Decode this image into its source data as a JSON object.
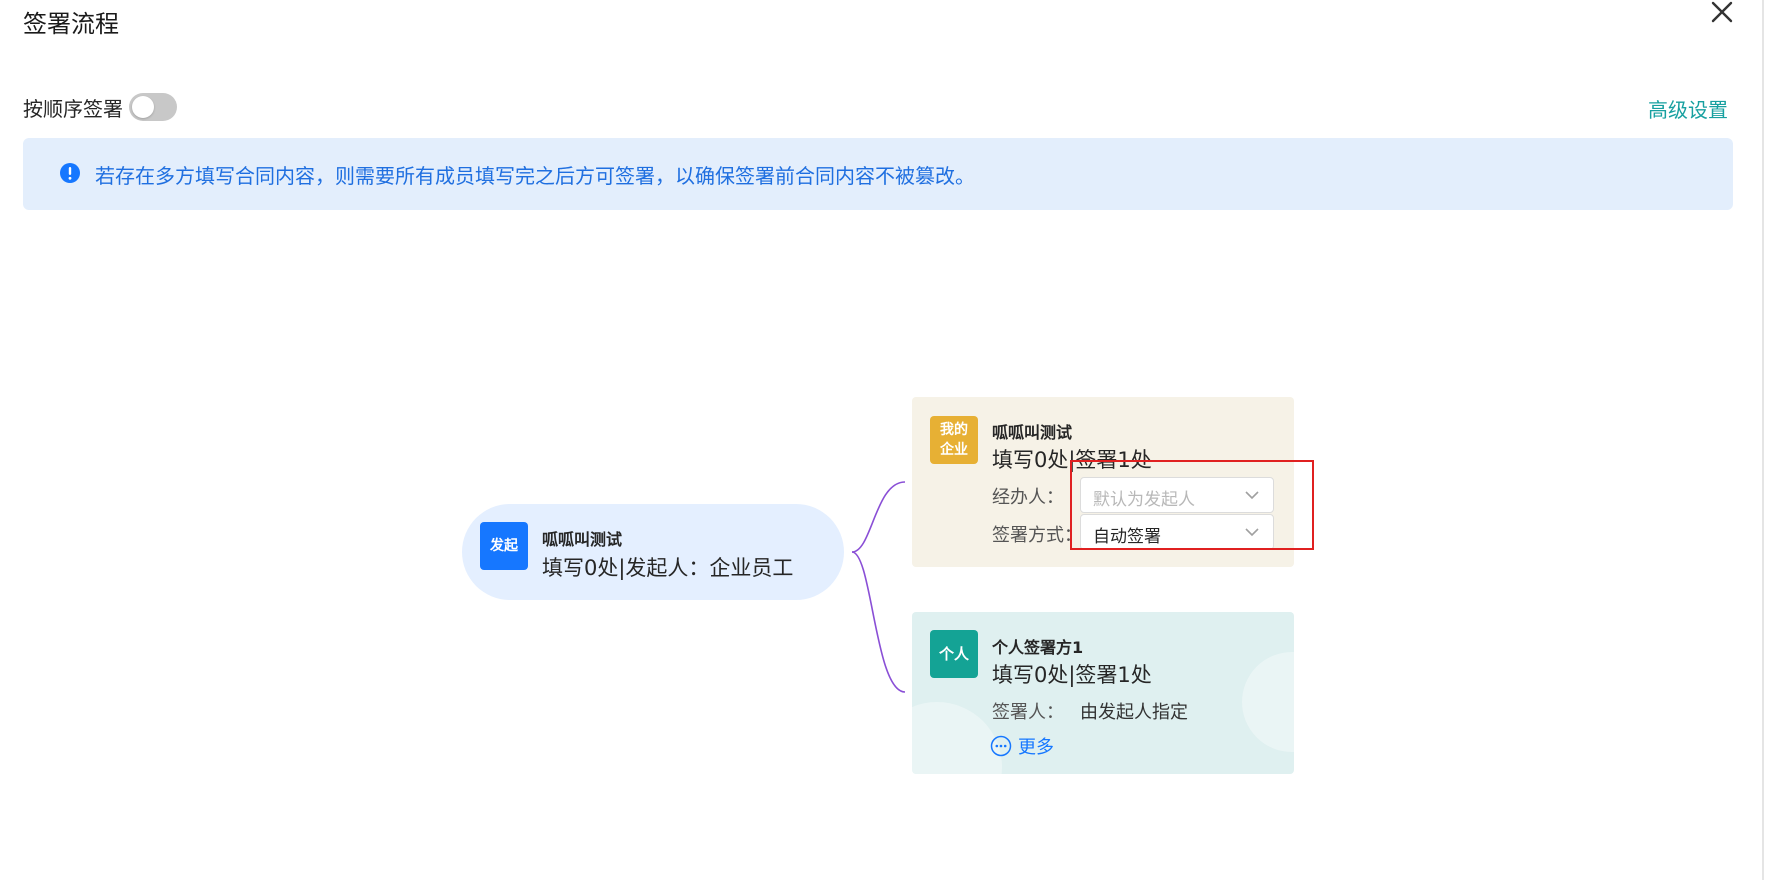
{
  "dialog": {
    "title": "签署流程",
    "close_icon": "close-icon"
  },
  "options": {
    "sequential_label": "按顺序签署",
    "sequential_enabled": false,
    "advanced_label": "高级设置"
  },
  "notice": {
    "icon": "info-icon",
    "text": "若存在多方填写合同内容，则需要所有成员填写完之后方可签署，以确保签署前合同内容不被篡改。"
  },
  "flow": {
    "start": {
      "badge": "发起",
      "name": "呱呱叫测试",
      "summary": "填写0处|发起人：企业员工"
    },
    "enterprise": {
      "badge": "我的企业",
      "name": "呱呱叫测试",
      "summary": "填写0处|签署1处",
      "handler_label": "经办人：",
      "handler_placeholder": "默认为发起人",
      "method_label": "签署方式：",
      "method_value": "自动签署"
    },
    "person": {
      "badge": "个人",
      "name": "个人签署方1",
      "summary": "填写0处|签署1处",
      "signer_label": "签署人：",
      "signer_value": "由发起人指定",
      "more_label": "更多"
    }
  },
  "colors": {
    "accent_teal": "#17a0a0",
    "notice_bg": "#e3eefc",
    "notice_text": "#1f6fe0",
    "start_badge": "#1677ff",
    "enterprise_badge": "#e7b034",
    "person_badge": "#14a395",
    "highlight": "#e02020",
    "connector": "#8a4fd6"
  }
}
